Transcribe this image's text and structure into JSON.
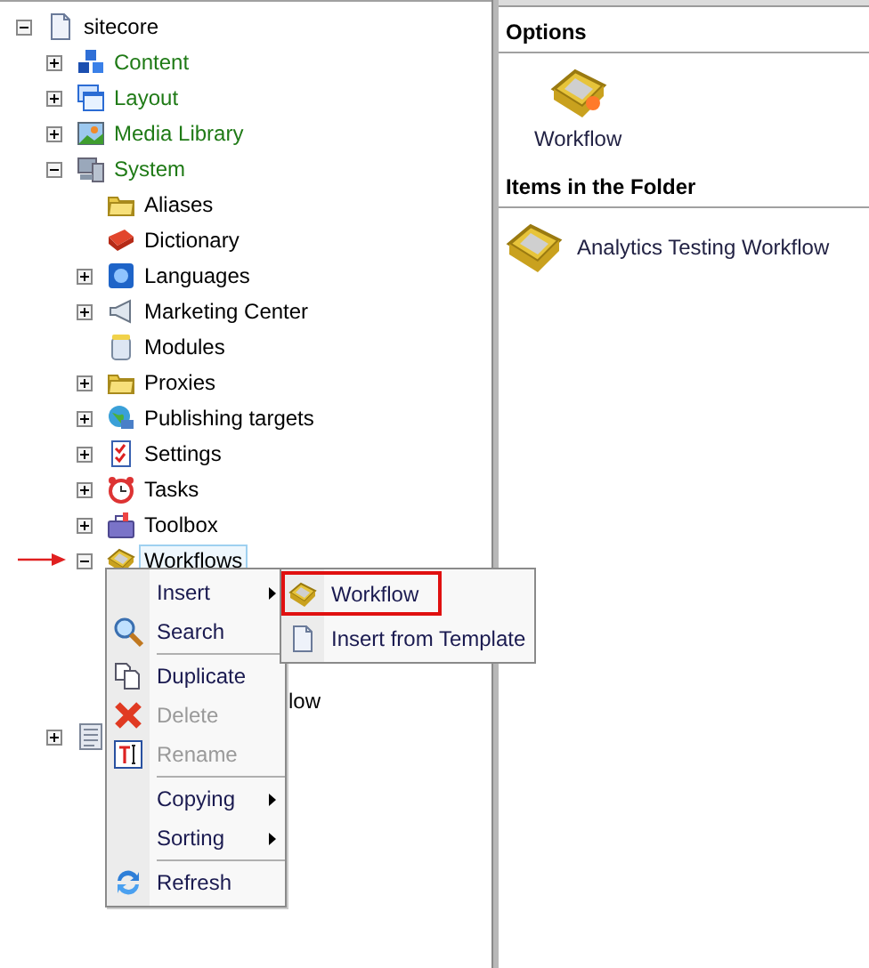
{
  "tree": [
    {
      "label": "sitecore",
      "expanded": true,
      "selected": false,
      "children": [
        {
          "label": "Content",
          "kind": "section",
          "expanded": false,
          "selected": false
        },
        {
          "label": "Layout",
          "kind": "section",
          "expanded": false,
          "selected": false
        },
        {
          "label": "Media Library",
          "kind": "section",
          "expanded": false,
          "selected": false
        },
        {
          "label": "System",
          "kind": "section",
          "expanded": true,
          "selected": false,
          "children": [
            {
              "label": "Aliases",
              "selected": false
            },
            {
              "label": "Dictionary",
              "selected": false
            },
            {
              "label": "Languages",
              "expanded": false,
              "selected": false
            },
            {
              "label": "Marketing Center",
              "expanded": false,
              "selected": false
            },
            {
              "label": "Modules",
              "selected": false
            },
            {
              "label": "Proxies",
              "expanded": false,
              "selected": false
            },
            {
              "label": "Publishing targets",
              "expanded": false,
              "selected": false
            },
            {
              "label": "Settings",
              "expanded": false,
              "selected": false
            },
            {
              "label": "Tasks",
              "expanded": false,
              "selected": false
            },
            {
              "label": "Toolbox",
              "expanded": false,
              "selected": false
            },
            {
              "label": "Workflows",
              "expanded": true,
              "selected": true,
              "children": [
                {
                  "label": "low"
                }
              ]
            }
          ]
        },
        {
          "expanded": false
        }
      ]
    }
  ],
  "context_menu": [
    {
      "kind": "item",
      "label": "Insert",
      "submenu": true,
      "disabled": false
    },
    {
      "kind": "item",
      "label": "Search",
      "submenu": false,
      "disabled": false
    },
    {
      "kind": "separator"
    },
    {
      "kind": "item",
      "label": "Duplicate",
      "submenu": false,
      "disabled": false
    },
    {
      "kind": "item",
      "label": "Delete",
      "submenu": false,
      "disabled": true
    },
    {
      "kind": "item",
      "label": "Rename",
      "submenu": false,
      "disabled": true
    },
    {
      "kind": "separator"
    },
    {
      "kind": "item",
      "label": "Copying",
      "submenu": true,
      "disabled": false
    },
    {
      "kind": "item",
      "label": "Sorting",
      "submenu": true,
      "disabled": false
    },
    {
      "kind": "separator"
    },
    {
      "kind": "item",
      "label": "Refresh",
      "submenu": false,
      "disabled": false
    }
  ],
  "submenu": [
    {
      "label": "Workflow",
      "highlighted": true
    },
    {
      "label": "Insert from Template",
      "highlighted": false
    }
  ],
  "options": {
    "title": "Options",
    "items": [
      {
        "label": "Workflow"
      }
    ]
  },
  "folder_items": {
    "title": "Items in the Folder",
    "items": [
      {
        "label": "Analytics Testing Workflow"
      }
    ]
  }
}
